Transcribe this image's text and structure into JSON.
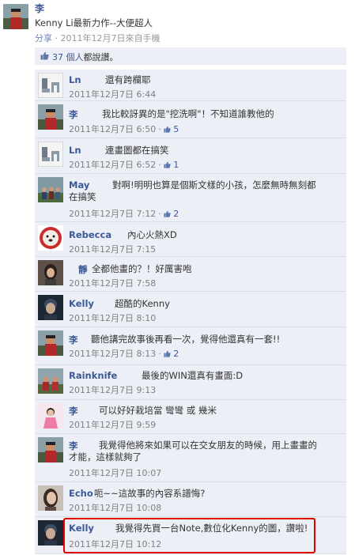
{
  "post": {
    "author": "李",
    "text": "Kenny Li最新力作--大便超人",
    "share_label": "分享",
    "meta": "· 2011年12月7日來自手機"
  },
  "likes": {
    "count": "37 個人",
    "suffix": "都說讚。"
  },
  "comments": [
    {
      "avatar": "ln-logo-avatar",
      "name": "Ln",
      "text": "還有跨欄耶",
      "date": "2011年12月7日 6:44",
      "likes": ""
    },
    {
      "avatar": "cyclist-avatar",
      "name": "李",
      "text": "我比較訝異的是\"挖洗啊\"！不知道誰教他的",
      "date": "2011年12月7日 6:50",
      "likes": "5"
    },
    {
      "avatar": "ln-logo-avatar",
      "name": "Ln",
      "text": "連畫圖都在搞笑",
      "date": "2011年12月7日 6:52",
      "likes": "1"
    },
    {
      "avatar": "group-photo-avatar",
      "name": "May",
      "text": "對啊!明明也算是個斯文樣的小孩，怎麼無時無刻都",
      "text2": "在搞笑",
      "date": "2011年12月7日 7:12",
      "likes": "2"
    },
    {
      "avatar": "dog-avatar",
      "name": "Rebecca",
      "text": "內心火熱XD",
      "date": "2011年12月7日 7:15",
      "likes": ""
    },
    {
      "avatar": "woman-avatar",
      "name": "靜",
      "text": "全都他畫的？！好厲害咆",
      "date": "2011年12月7日 7:58",
      "likes": ""
    },
    {
      "avatar": "man-avatar",
      "name": "Kelly",
      "text": "超酷的Kenny",
      "date": "2011年12月7日 8:10",
      "likes": ""
    },
    {
      "avatar": "cyclist-avatar",
      "name": "李",
      "text": "聽他講完故事後再看一次，覺得他還真有一套!!",
      "date": "2011年12月7日 8:13",
      "likes": "2"
    },
    {
      "avatar": "cyclist-group-avatar",
      "name": "Rainknife",
      "text": "最後的WIN還真有畫面:D",
      "date": "2011年12月7日 9:13",
      "likes": ""
    },
    {
      "avatar": "girl-pink-avatar",
      "name": "李",
      "text": "可以好好栽培當 彎彎 或 幾米",
      "date": "2011年12月7日 9:59",
      "likes": ""
    },
    {
      "avatar": "cyclist-avatar",
      "name": "李",
      "text": "我覺得他將來如果可以在交女朋友的時候，用上畫畫的",
      "text2": "才能，這樣就夠了",
      "date": "2011年12月7日 10:07",
      "likes": ""
    },
    {
      "avatar": "woman2-avatar",
      "name": "Echo",
      "text": "呃~~這故事的內容系譜悔?",
      "date": "2011年12月7日 10:08",
      "likes": ""
    },
    {
      "avatar": "man-avatar",
      "name": "Kelly",
      "text": "我覺得先買一台Note,數位化Kenny的圖，讚啦!",
      "date": "2011年12月7日  10:12",
      "likes": ""
    }
  ],
  "colors": {
    "link": "#3b5998",
    "comment_bg": "#eceff5",
    "highlight": "#e00000"
  }
}
